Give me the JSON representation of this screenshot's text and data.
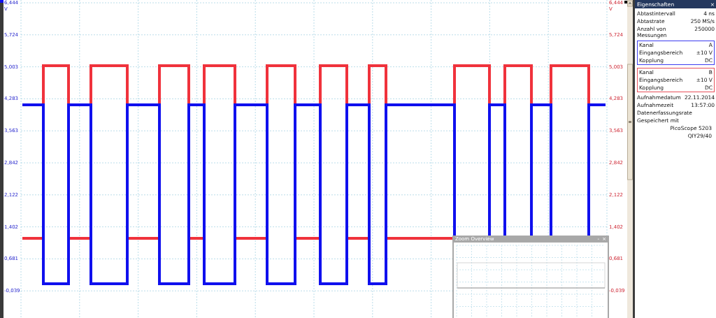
{
  "plot": {
    "left_axis": {
      "unit": "V",
      "ticks": [
        "6,444",
        "5,724",
        "5,003",
        "4,283",
        "3,563",
        "2,842",
        "2,122",
        "1,402",
        "0,681",
        "-0,039"
      ]
    },
    "right_axis": {
      "unit": "V",
      "ticks": [
        "6,444",
        "5,724",
        "5,003",
        "4,283",
        "3,563",
        "2,842",
        "2,122",
        "1,402",
        "0,681",
        "-0,039"
      ]
    }
  },
  "properties": {
    "title": "Eigenschaften",
    "close": "×",
    "rows": [
      {
        "label": "Abtastintervall",
        "value": "4 ns"
      },
      {
        "label": "Abtastrate",
        "value": "250 MS/s"
      },
      {
        "label": "Anzahl von Messungen",
        "value": "250000"
      }
    ],
    "channels": [
      {
        "color": "#3c3cf0",
        "rows": [
          {
            "label": "Kanal",
            "value": "A"
          },
          {
            "label": "Eingangsbereich",
            "value": "±10 V"
          },
          {
            "label": "Kopplung",
            "value": "DC"
          }
        ]
      },
      {
        "color": "#e8505a",
        "rows": [
          {
            "label": "Kanal",
            "value": "B"
          },
          {
            "label": "Eingangsbereich",
            "value": "±10 V"
          },
          {
            "label": "Kopplung",
            "value": "DC"
          }
        ]
      }
    ],
    "info": [
      {
        "label": "Aufnahmedatum",
        "value": "22.11.2014"
      },
      {
        "label": "Aufnahmezeit",
        "value": "13:57:00"
      },
      {
        "label": "Datenerfassungsrate"
      },
      {
        "label": "Gespeichert mit"
      }
    ],
    "footer": [
      "PicoScope 5203",
      "QIY29/40"
    ]
  },
  "zoom_overview": {
    "title": "Zoom Overview",
    "buttons": [
      "-",
      "×"
    ]
  }
}
